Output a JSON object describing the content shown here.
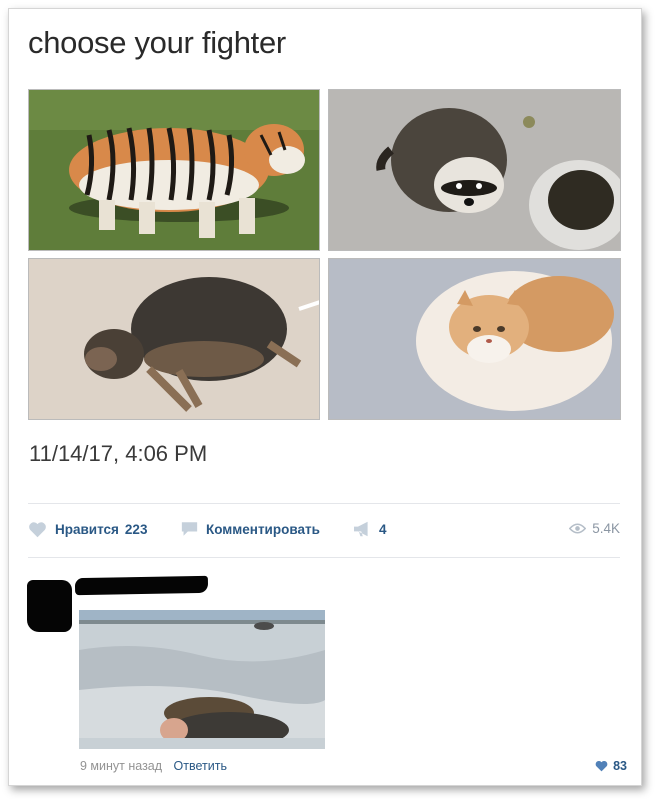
{
  "post": {
    "title": "choose your fighter",
    "date": "11/14/17, 4:06 PM",
    "images": [
      {
        "icon": "tiger-photo"
      },
      {
        "icon": "raccoon-photo"
      },
      {
        "icon": "dog-photo"
      },
      {
        "icon": "cat-photo"
      }
    ]
  },
  "actions": {
    "like_label": "Нравится",
    "like_count": "223",
    "comment_label": "Комментировать",
    "share_count": "4",
    "views": "5.4K"
  },
  "comment": {
    "time": "9 минут назад",
    "reply_label": "Ответить",
    "likes": "83"
  },
  "colors": {
    "link": "#2a5885",
    "icon_grey": "#c5d0db",
    "meta_grey": "#939393",
    "heart_blue": "#5181b8"
  }
}
